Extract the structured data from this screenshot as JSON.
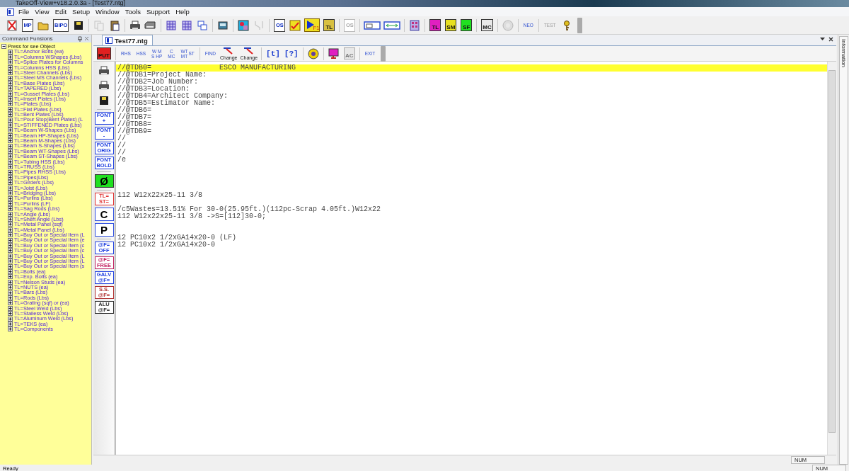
{
  "window": {
    "title": "TakeOff-View+v18.2.0.3a - [Test77.ntg]"
  },
  "menu": [
    "File",
    "View",
    "Edit",
    "Setup",
    "Window",
    "Tools",
    "Support",
    "Help"
  ],
  "toolbar": [
    {
      "kind": "cross"
    },
    {
      "kind": "doc",
      "label": "MP"
    },
    {
      "kind": "folder"
    },
    {
      "kind": "doc",
      "label": "BIPO"
    },
    {
      "kind": "floppy"
    },
    {
      "kind": "sep"
    },
    {
      "kind": "copy",
      "disabled": true
    },
    {
      "kind": "paste",
      "disabled": false
    },
    {
      "kind": "sep"
    },
    {
      "kind": "printer"
    },
    {
      "kind": "scanner"
    },
    {
      "kind": "sep"
    },
    {
      "kind": "grid"
    },
    {
      "kind": "grid"
    },
    {
      "kind": "windows"
    },
    {
      "kind": "sep"
    },
    {
      "kind": "picture"
    },
    {
      "kind": "sep"
    },
    {
      "kind": "swatch"
    },
    {
      "kind": "plug",
      "disabled": true
    },
    {
      "kind": "sep"
    },
    {
      "kind": "doc",
      "label": "OS"
    },
    {
      "kind": "check"
    },
    {
      "kind": "play",
      "label": "F1"
    },
    {
      "kind": "badge",
      "label": "TL",
      "color": "#d8c040"
    },
    {
      "kind": "sep"
    },
    {
      "kind": "doc",
      "label": "OS",
      "disabled": true
    },
    {
      "kind": "sep"
    },
    {
      "kind": "window"
    },
    {
      "kind": "span"
    },
    {
      "kind": "sep"
    },
    {
      "kind": "calc"
    },
    {
      "kind": "sep"
    },
    {
      "kind": "badge",
      "label": "TL",
      "color": "#e020c0"
    },
    {
      "kind": "badge",
      "label": "SM",
      "color": "#e8e020"
    },
    {
      "kind": "badge",
      "label": "SF",
      "color": "#20e020"
    },
    {
      "kind": "sep"
    },
    {
      "kind": "badge",
      "label": "MC",
      "color": "#e8e8e8"
    },
    {
      "kind": "sep"
    },
    {
      "kind": "disc",
      "disabled": true
    },
    {
      "kind": "sep"
    },
    {
      "kind": "text",
      "label": "NEO"
    },
    {
      "kind": "sep"
    },
    {
      "kind": "text",
      "label": "TEST",
      "disabled": true
    },
    {
      "kind": "key"
    }
  ],
  "panel": {
    "title": "Command Funsions",
    "root": {
      "label": "Press for see Object",
      "expanded": true,
      "children": [
        {
          "label": "TL=Anchor Bolts (ea)",
          "expanded": false
        },
        {
          "label": "TL=Columns WShapes (Lbs)",
          "expanded": false
        },
        {
          "label": "TL=Splice Plates for Columns",
          "expanded": false
        },
        {
          "label": "TL=Columns HSS (Lbs)",
          "expanded": false
        },
        {
          "label": "TL=Steel Channels (Lbs)",
          "expanded": false
        },
        {
          "label": "TL=Steel MS Channels (Lbs)",
          "expanded": false
        },
        {
          "label": "TL=Base Plates (Lbs)",
          "expanded": false
        },
        {
          "label": "TL=TAPERED (Lbs)",
          "expanded": false
        },
        {
          "label": "TL=Gusset Plates (Lbs)",
          "expanded": false
        },
        {
          "label": "TL=Insert Plates (Lbs)",
          "expanded": false
        },
        {
          "label": "TL=Plates (Lbs)",
          "expanded": false
        },
        {
          "label": "TL=Flat Plates (Lbs)",
          "expanded": false
        },
        {
          "label": "TL=Bent Plates (Lbs)",
          "expanded": false
        },
        {
          "label": "TL=Pour Stop(Bent Plates) (L",
          "expanded": false
        },
        {
          "label": "TL=STIFFENED Plates (Lbs)",
          "expanded": false
        },
        {
          "label": "TL=Beam W-Shapes (Lbs)",
          "expanded": false
        },
        {
          "label": "TL=Beam HP-Shapes (Lbs)",
          "expanded": false
        },
        {
          "label": "TL=Beam M-Shapes (Lbs)",
          "expanded": false
        },
        {
          "label": "TL=Beam S-Shapes (Lbs)",
          "expanded": false
        },
        {
          "label": "TL=Beam WT-Shapes (Lbs)",
          "expanded": false
        },
        {
          "label": "TL=Beam ST-Shapes (Lbs)",
          "expanded": false
        },
        {
          "label": "TL=Tubing HSS (Lbs)",
          "expanded": false
        },
        {
          "label": "TL=TRUSS (Lbs)",
          "expanded": false
        },
        {
          "label": "TL=Pipes RHSS (Lbs)",
          "expanded": false
        },
        {
          "label": "TL=Pipes(Lbs)",
          "expanded": false
        },
        {
          "label": "TL=Girders (Lbs)",
          "expanded": false
        },
        {
          "label": "TL=Joist (Lbs)",
          "expanded": false
        },
        {
          "label": "TL=Bridging (Lbs)",
          "expanded": false
        },
        {
          "label": "TL=Purlins (Lbs)",
          "expanded": false
        },
        {
          "label": "TL=Purlins (LF)",
          "expanded": false
        },
        {
          "label": "TL=Sag Rods (Lbs)",
          "expanded": false
        },
        {
          "label": "TL=Angle (Lbs)",
          "expanded": false
        },
        {
          "label": "TL=Sheft Angle (Lbs)",
          "expanded": false
        },
        {
          "label": "TL=Metal Panel (sqf)",
          "expanded": false
        },
        {
          "label": "TL=Metal Panel (Lbs)",
          "expanded": false
        },
        {
          "label": "TL=Buy Out or Special Item (L",
          "expanded": false
        },
        {
          "label": "TL=Buy Out or Special Item (e",
          "expanded": false
        },
        {
          "label": "TL=Buy Out or Special Item (c",
          "expanded": false
        },
        {
          "label": "TL=Buy Out or Special Item (c",
          "expanded": false
        },
        {
          "label": "TL=Buy Out or Special Item (L",
          "expanded": false
        },
        {
          "label": "TL=Buy Out or Special Item (L",
          "expanded": false
        },
        {
          "label": "TL=Buy Out or Special Item (s",
          "expanded": false
        },
        {
          "label": "TL=Bolts (ea)",
          "expanded": false
        },
        {
          "label": "TL=Exp. Bolts (ea)",
          "expanded": false
        },
        {
          "label": "TL=Nelson Studs (ea)",
          "expanded": false
        },
        {
          "label": "TL=NUTS (ea)",
          "expanded": false
        },
        {
          "label": "TL=Bars (Lbs)",
          "expanded": false
        },
        {
          "label": "TL=Rods (Lbs)",
          "expanded": false
        },
        {
          "label": "TL=Grating (sqf) or (ea)",
          "expanded": false
        },
        {
          "label": "TL=Steel Weld (Lbs)",
          "expanded": false
        },
        {
          "label": "TL=Stailess Weld (Lbs)",
          "expanded": false
        },
        {
          "label": "TL=Aluminum Weld (Lbs)",
          "expanded": false
        },
        {
          "label": "TL=TEKS (ea)",
          "expanded": false
        },
        {
          "label": "TL=Components",
          "expanded": false
        }
      ]
    }
  },
  "tabs": [
    {
      "label": "Test77.ntg",
      "selected": true
    }
  ],
  "doc_toolbar": [
    {
      "kind": "badge",
      "label": "PUT",
      "color": "#e02020"
    },
    {
      "kind": "sep"
    },
    {
      "kind": "text",
      "lines": [
        "RHS"
      ]
    },
    {
      "kind": "text",
      "lines": [
        "HSS"
      ]
    },
    {
      "kind": "text",
      "lines": [
        "W M",
        "S HP"
      ]
    },
    {
      "kind": "text",
      "lines": [
        "C",
        "MC"
      ]
    },
    {
      "kind": "text",
      "lines": [
        "WT",
        "MT"
      ],
      "suffix": "ST"
    },
    {
      "kind": "sep"
    },
    {
      "kind": "text",
      "lines": [
        "FIND"
      ]
    },
    {
      "kind": "change",
      "label": "Change"
    },
    {
      "kind": "change",
      "label": "Change"
    },
    {
      "kind": "sep"
    },
    {
      "kind": "bracket",
      "label": "[t]"
    },
    {
      "kind": "bracket",
      "label": "[?]"
    },
    {
      "kind": "sep"
    },
    {
      "kind": "disc"
    },
    {
      "kind": "sep"
    },
    {
      "kind": "monitor"
    },
    {
      "kind": "badge",
      "label": "AC",
      "color": "#e8e8e8",
      "disabled": true
    },
    {
      "kind": "sep"
    },
    {
      "kind": "text",
      "lines": [
        "EXIT"
      ]
    }
  ],
  "side_toolbar": [
    {
      "kind": "printer"
    },
    {
      "kind": "printer"
    },
    {
      "kind": "floppy"
    },
    {
      "kind": "sep"
    },
    {
      "kind": "boxed",
      "lines": [
        "FONT",
        "+"
      ],
      "color": "#2040e0"
    },
    {
      "kind": "boxed",
      "lines": [
        "FONT",
        "-"
      ],
      "color": "#2040e0"
    },
    {
      "kind": "boxed",
      "lines": [
        "FONT",
        "ORIG"
      ],
      "color": "#2040e0"
    },
    {
      "kind": "boxed",
      "lines": [
        "FONT",
        "BOLD"
      ],
      "color": "#2040e0"
    },
    {
      "kind": "sep"
    },
    {
      "kind": "fill",
      "lines": [
        "Ø"
      ],
      "color": "#20e020"
    },
    {
      "kind": "sep"
    },
    {
      "kind": "boxed",
      "lines": [
        "TL=",
        "ST="
      ],
      "color": "#e03030"
    },
    {
      "kind": "big",
      "lines": [
        "C"
      ]
    },
    {
      "kind": "big",
      "lines": [
        "P"
      ]
    },
    {
      "kind": "sep"
    },
    {
      "kind": "boxed",
      "lines": [
        "@F=",
        "OFF"
      ],
      "color": "#2040e0"
    },
    {
      "kind": "boxed",
      "lines": [
        "@F=",
        "FREE"
      ],
      "color": "#c02060"
    },
    {
      "kind": "boxed",
      "lines": [
        "GALV",
        "@F="
      ],
      "color": "#2040e0"
    },
    {
      "kind": "boxed",
      "lines": [
        "S.S.",
        "@F="
      ],
      "color": "#b03030"
    },
    {
      "kind": "boxed",
      "lines": [
        "ALU",
        "@F="
      ],
      "color": "#303030"
    }
  ],
  "editor": {
    "lines": [
      {
        "kind": "text",
        "text": "//@TDB0=                ESCO MANUFACTURING",
        "current": true
      },
      {
        "kind": "text",
        "text": "//@TDB1=Project Name:",
        "current": false
      },
      {
        "kind": "text",
        "text": "//@TDB2=Job Number:",
        "current": false
      },
      {
        "kind": "text",
        "text": "//@TDB3=Location:",
        "current": false
      },
      {
        "kind": "text",
        "text": "//@TDB4=Architect Company:",
        "current": false
      },
      {
        "kind": "text",
        "text": "//@TDB5=Estimator Name:",
        "current": false
      },
      {
        "kind": "text",
        "text": "//@TDB6=",
        "current": false
      },
      {
        "kind": "text",
        "text": "//@TDB7=",
        "current": false
      },
      {
        "kind": "text",
        "text": "//@TDB8=",
        "current": false
      },
      {
        "kind": "text",
        "text": "//@TDB9=",
        "current": false
      },
      {
        "kind": "text",
        "text": "//",
        "current": false
      },
      {
        "kind": "text",
        "text": "//",
        "current": false
      },
      {
        "kind": "text",
        "text": "//",
        "current": false
      },
      {
        "kind": "text",
        "text": "/e",
        "current": false
      },
      {
        "kind": "blank"
      },
      {
        "kind": "blank"
      },
      {
        "kind": "blank"
      },
      {
        "kind": "blank"
      },
      {
        "kind": "text",
        "text": "112 W12x22x25-11 3/8",
        "current": false
      },
      {
        "kind": "blank"
      },
      {
        "kind": "text",
        "text": "/c5Wastes=13.51% For 30-0(25.95ft.)(112pc-Scrap 4.05ft.)W12x22",
        "current": false
      },
      {
        "kind": "text",
        "text": "112 W12x22x25-11 3/8 ->S=[112]30-0;",
        "current": false
      },
      {
        "kind": "blank"
      },
      {
        "kind": "blank"
      },
      {
        "kind": "text",
        "text": "12 PC10x2 1/2xGA14x20-0 (LF)",
        "current": false
      },
      {
        "kind": "text",
        "text": "12 PC10x2 1/2xGA14x20-0",
        "current": false
      }
    ]
  },
  "side_tab": "Information",
  "doc_status": "NUM",
  "status_bar": {
    "message": "Ready",
    "indicator": "NUM"
  }
}
